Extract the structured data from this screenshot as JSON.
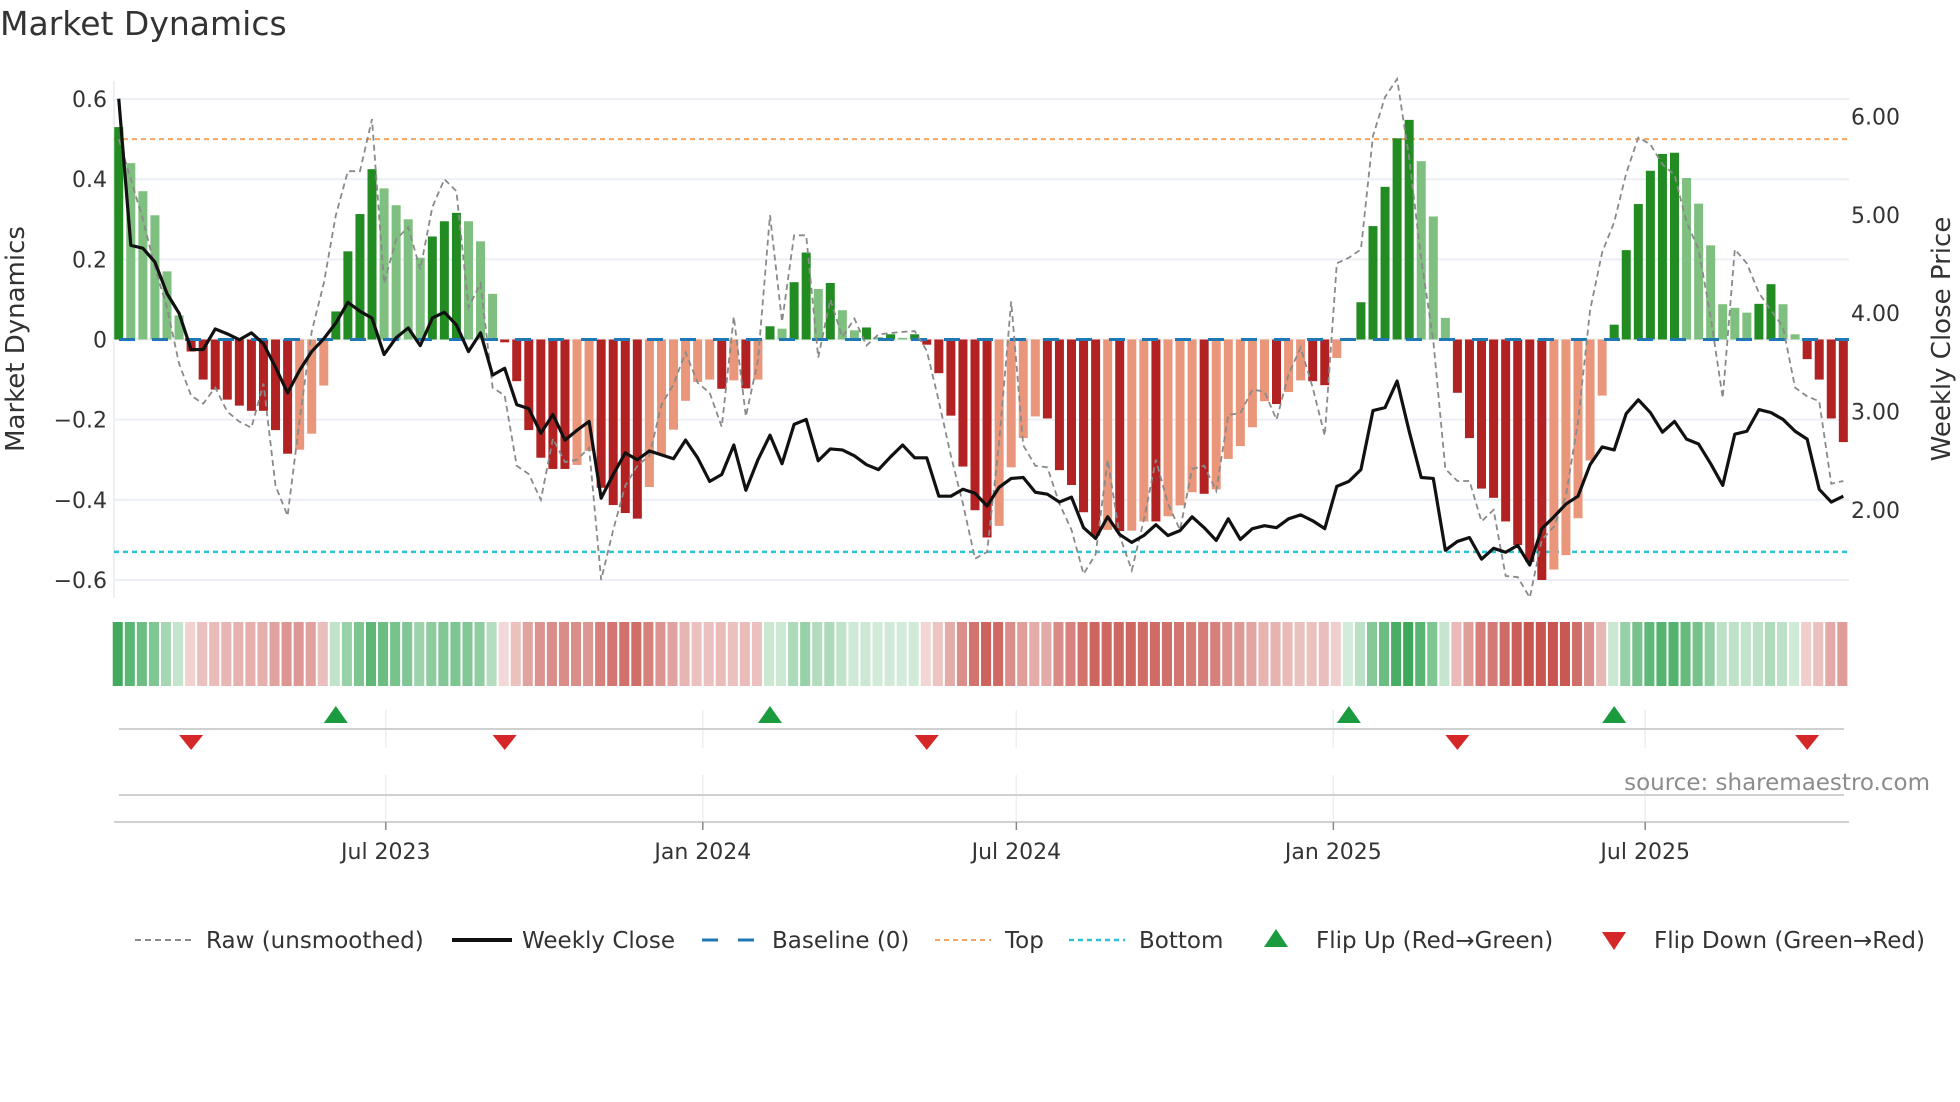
{
  "title": "Market Dynamics",
  "source": "source: sharemaestro.com",
  "chart_data": {
    "type": "bar",
    "title": "Market Dynamics",
    "ylabel": "Market Dynamics",
    "y2label": "Weekly Close Price",
    "ylim": [
      -0.645,
      0.645
    ],
    "y2lim": [
      1.105,
      6.36
    ],
    "x_start": "2023-01-27",
    "x_step_days": 7,
    "yticks": [
      0.6,
      0.4,
      0.2,
      0,
      -0.2,
      -0.4,
      -0.6
    ],
    "ytick_labels": [
      "0.6",
      "0.4",
      "0.2",
      "0",
      "−0.2",
      "−0.4",
      "−0.6"
    ],
    "y2ticks": [
      6,
      5,
      4,
      3,
      2
    ],
    "y2tick_labels": [
      "6.00",
      "5.00",
      "4.00",
      "3.00",
      "2.00"
    ],
    "xticks": [
      {
        "date": "2023-07-01",
        "label": "Jul 2023"
      },
      {
        "date": "2024-01-01",
        "label": "Jan 2024"
      },
      {
        "date": "2024-07-01",
        "label": "Jul 2024"
      },
      {
        "date": "2025-01-01",
        "label": "Jan 2025"
      },
      {
        "date": "2025-07-01",
        "label": "Jul 2025"
      }
    ],
    "top_level": 0.5,
    "bottom_level": -0.53,
    "baseline": 0,
    "legend": {
      "position": "bottom",
      "items": [
        {
          "label": "Raw (unsmoothed)",
          "kind": "raw"
        },
        {
          "label": "Weekly Close",
          "kind": "close"
        },
        {
          "label": "Baseline (0)",
          "kind": "baseline"
        },
        {
          "label": "Top",
          "kind": "top"
        },
        {
          "label": "Bottom",
          "kind": "bottom"
        },
        {
          "label": "Flip Up (Red→Green)",
          "kind": "flipup"
        },
        {
          "label": "Flip Down (Green→Red)",
          "kind": "flipdown"
        }
      ]
    },
    "colors": {
      "rising_positive": "#228b22",
      "falling_positive": "#7fbf7f",
      "falling_negative": "#b22222",
      "rising_negative": "#e9967a",
      "raw": "#8a8a8a",
      "close": "#111111",
      "baseline": "#1f77b4",
      "top": "#f4a460",
      "bottom": "#2ec4d6",
      "flip_up": "#1a9c3e",
      "flip_down": "#d62728",
      "heat_green": "#3ca85a",
      "heat_red": "#c8554f"
    },
    "values": [
      0.53,
      0.44,
      0.37,
      0.31,
      0.17,
      0.06,
      -0.03,
      -0.1,
      -0.125,
      -0.15,
      -0.165,
      -0.178,
      -0.178,
      -0.226,
      -0.285,
      -0.275,
      -0.235,
      -0.115,
      0.07,
      0.22,
      0.313,
      0.425,
      0.377,
      0.335,
      0.3,
      0.204,
      0.257,
      0.295,
      0.316,
      0.295,
      0.245,
      0.114,
      -0.007,
      -0.104,
      -0.226,
      -0.295,
      -0.323,
      -0.323,
      -0.313,
      -0.278,
      -0.37,
      -0.413,
      -0.433,
      -0.447,
      -0.368,
      -0.288,
      -0.225,
      -0.153,
      -0.106,
      -0.1,
      -0.123,
      -0.102,
      -0.122,
      -0.1,
      0.033,
      0.027,
      0.143,
      0.217,
      0.126,
      0.141,
      0.073,
      0.023,
      0.03,
      0.006,
      0.013,
      0.004,
      0.013,
      -0.013,
      -0.084,
      -0.19,
      -0.317,
      -0.426,
      -0.494,
      -0.465,
      -0.319,
      -0.246,
      -0.192,
      -0.197,
      -0.326,
      -0.363,
      -0.431,
      -0.489,
      -0.475,
      -0.478,
      -0.477,
      -0.454,
      -0.454,
      -0.441,
      -0.414,
      -0.381,
      -0.385,
      -0.374,
      -0.298,
      -0.266,
      -0.219,
      -0.154,
      -0.161,
      -0.131,
      -0.102,
      -0.104,
      -0.114,
      -0.046,
      0.004,
      0.093,
      0.283,
      0.381,
      0.502,
      0.548,
      0.445,
      0.307,
      0.054,
      -0.133,
      -0.246,
      -0.372,
      -0.395,
      -0.454,
      -0.513,
      -0.555,
      -0.6,
      -0.574,
      -0.538,
      -0.446,
      -0.302,
      -0.14,
      0.037,
      0.223,
      0.338,
      0.421,
      0.463,
      0.466,
      0.403,
      0.339,
      0.235,
      0.088,
      0.079,
      0.067,
      0.089,
      0.138,
      0.088,
      0.013,
      -0.049,
      -0.1,
      -0.197,
      -0.256
    ],
    "raw": [
      0.5,
      0.4,
      0.3,
      0.18,
      0.08,
      -0.06,
      -0.14,
      -0.16,
      -0.12,
      -0.18,
      -0.205,
      -0.22,
      -0.11,
      -0.365,
      -0.44,
      -0.2,
      0.02,
      0.14,
      0.31,
      0.42,
      0.42,
      0.55,
      0.14,
      0.25,
      0.28,
      0.175,
      0.33,
      0.4,
      0.37,
      0.08,
      0.14,
      -0.12,
      -0.14,
      -0.315,
      -0.336,
      -0.4,
      -0.247,
      -0.306,
      -0.3,
      -0.27,
      -0.6,
      -0.475,
      -0.365,
      -0.315,
      -0.29,
      -0.163,
      -0.112,
      -0.032,
      -0.108,
      -0.133,
      -0.218,
      0.057,
      -0.192,
      -0.053,
      0.31,
      0.044,
      0.26,
      0.26,
      -0.045,
      0.1,
      0.006,
      0.052,
      -0.015,
      0.013,
      0.016,
      0.019,
      0.021,
      -0.028,
      -0.154,
      -0.29,
      -0.41,
      -0.547,
      -0.53,
      -0.256,
      0.095,
      -0.264,
      -0.315,
      -0.319,
      -0.41,
      -0.475,
      -0.585,
      -0.536,
      -0.3,
      -0.49,
      -0.576,
      -0.45,
      -0.3,
      -0.41,
      -0.475,
      -0.323,
      -0.315,
      -0.378,
      -0.188,
      -0.184,
      -0.125,
      -0.13,
      -0.2,
      -0.087,
      -0.02,
      -0.12,
      -0.24,
      0.19,
      0.204,
      0.225,
      0.508,
      0.605,
      0.65,
      0.453,
      0.2,
      -0.003,
      -0.323,
      -0.353,
      -0.353,
      -0.454,
      -0.425,
      -0.59,
      -0.593,
      -0.644,
      -0.5,
      -0.467,
      -0.39,
      -0.205,
      0.073,
      0.217,
      0.293,
      0.415,
      0.504,
      0.487,
      0.437,
      0.411,
      0.293,
      0.225,
      0.056,
      -0.146,
      0.225,
      0.19,
      0.116,
      0.073,
      0.031,
      -0.12,
      -0.142,
      -0.154,
      -0.36,
      -0.353
    ],
    "close": [
      6.18,
      4.69,
      4.66,
      4.52,
      4.2,
      4.0,
      3.63,
      3.63,
      3.84,
      3.79,
      3.73,
      3.8,
      3.69,
      3.45,
      3.19,
      3.42,
      3.61,
      3.74,
      3.9,
      4.11,
      4.02,
      3.95,
      3.58,
      3.75,
      3.85,
      3.67,
      3.95,
      4.01,
      3.88,
      3.61,
      3.8,
      3.37,
      3.44,
      3.07,
      3.03,
      2.78,
      2.97,
      2.71,
      2.81,
      2.9,
      2.12,
      2.36,
      2.58,
      2.51,
      2.6,
      2.56,
      2.52,
      2.71,
      2.53,
      2.29,
      2.36,
      2.66,
      2.2,
      2.51,
      2.76,
      2.47,
      2.87,
      2.92,
      2.5,
      2.62,
      2.61,
      2.55,
      2.46,
      2.41,
      2.54,
      2.66,
      2.53,
      2.53,
      2.14,
      2.14,
      2.21,
      2.17,
      2.04,
      2.23,
      2.32,
      2.33,
      2.18,
      2.16,
      2.08,
      2.13,
      1.82,
      1.71,
      1.93,
      1.75,
      1.67,
      1.74,
      1.85,
      1.74,
      1.79,
      1.93,
      1.82,
      1.69,
      1.91,
      1.7,
      1.81,
      1.84,
      1.82,
      1.91,
      1.95,
      1.89,
      1.81,
      2.24,
      2.29,
      2.41,
      3.01,
      3.04,
      3.31,
      2.8,
      2.33,
      2.32,
      1.59,
      1.68,
      1.72,
      1.5,
      1.61,
      1.57,
      1.64,
      1.44,
      1.81,
      1.93,
      2.06,
      2.14,
      2.46,
      2.64,
      2.61,
      2.98,
      3.12,
      2.99,
      2.79,
      2.9,
      2.72,
      2.67,
      2.47,
      2.25,
      2.77,
      2.8,
      3.02,
      2.99,
      2.92,
      2.8,
      2.72,
      2.21,
      2.08,
      2.14
    ]
  }
}
